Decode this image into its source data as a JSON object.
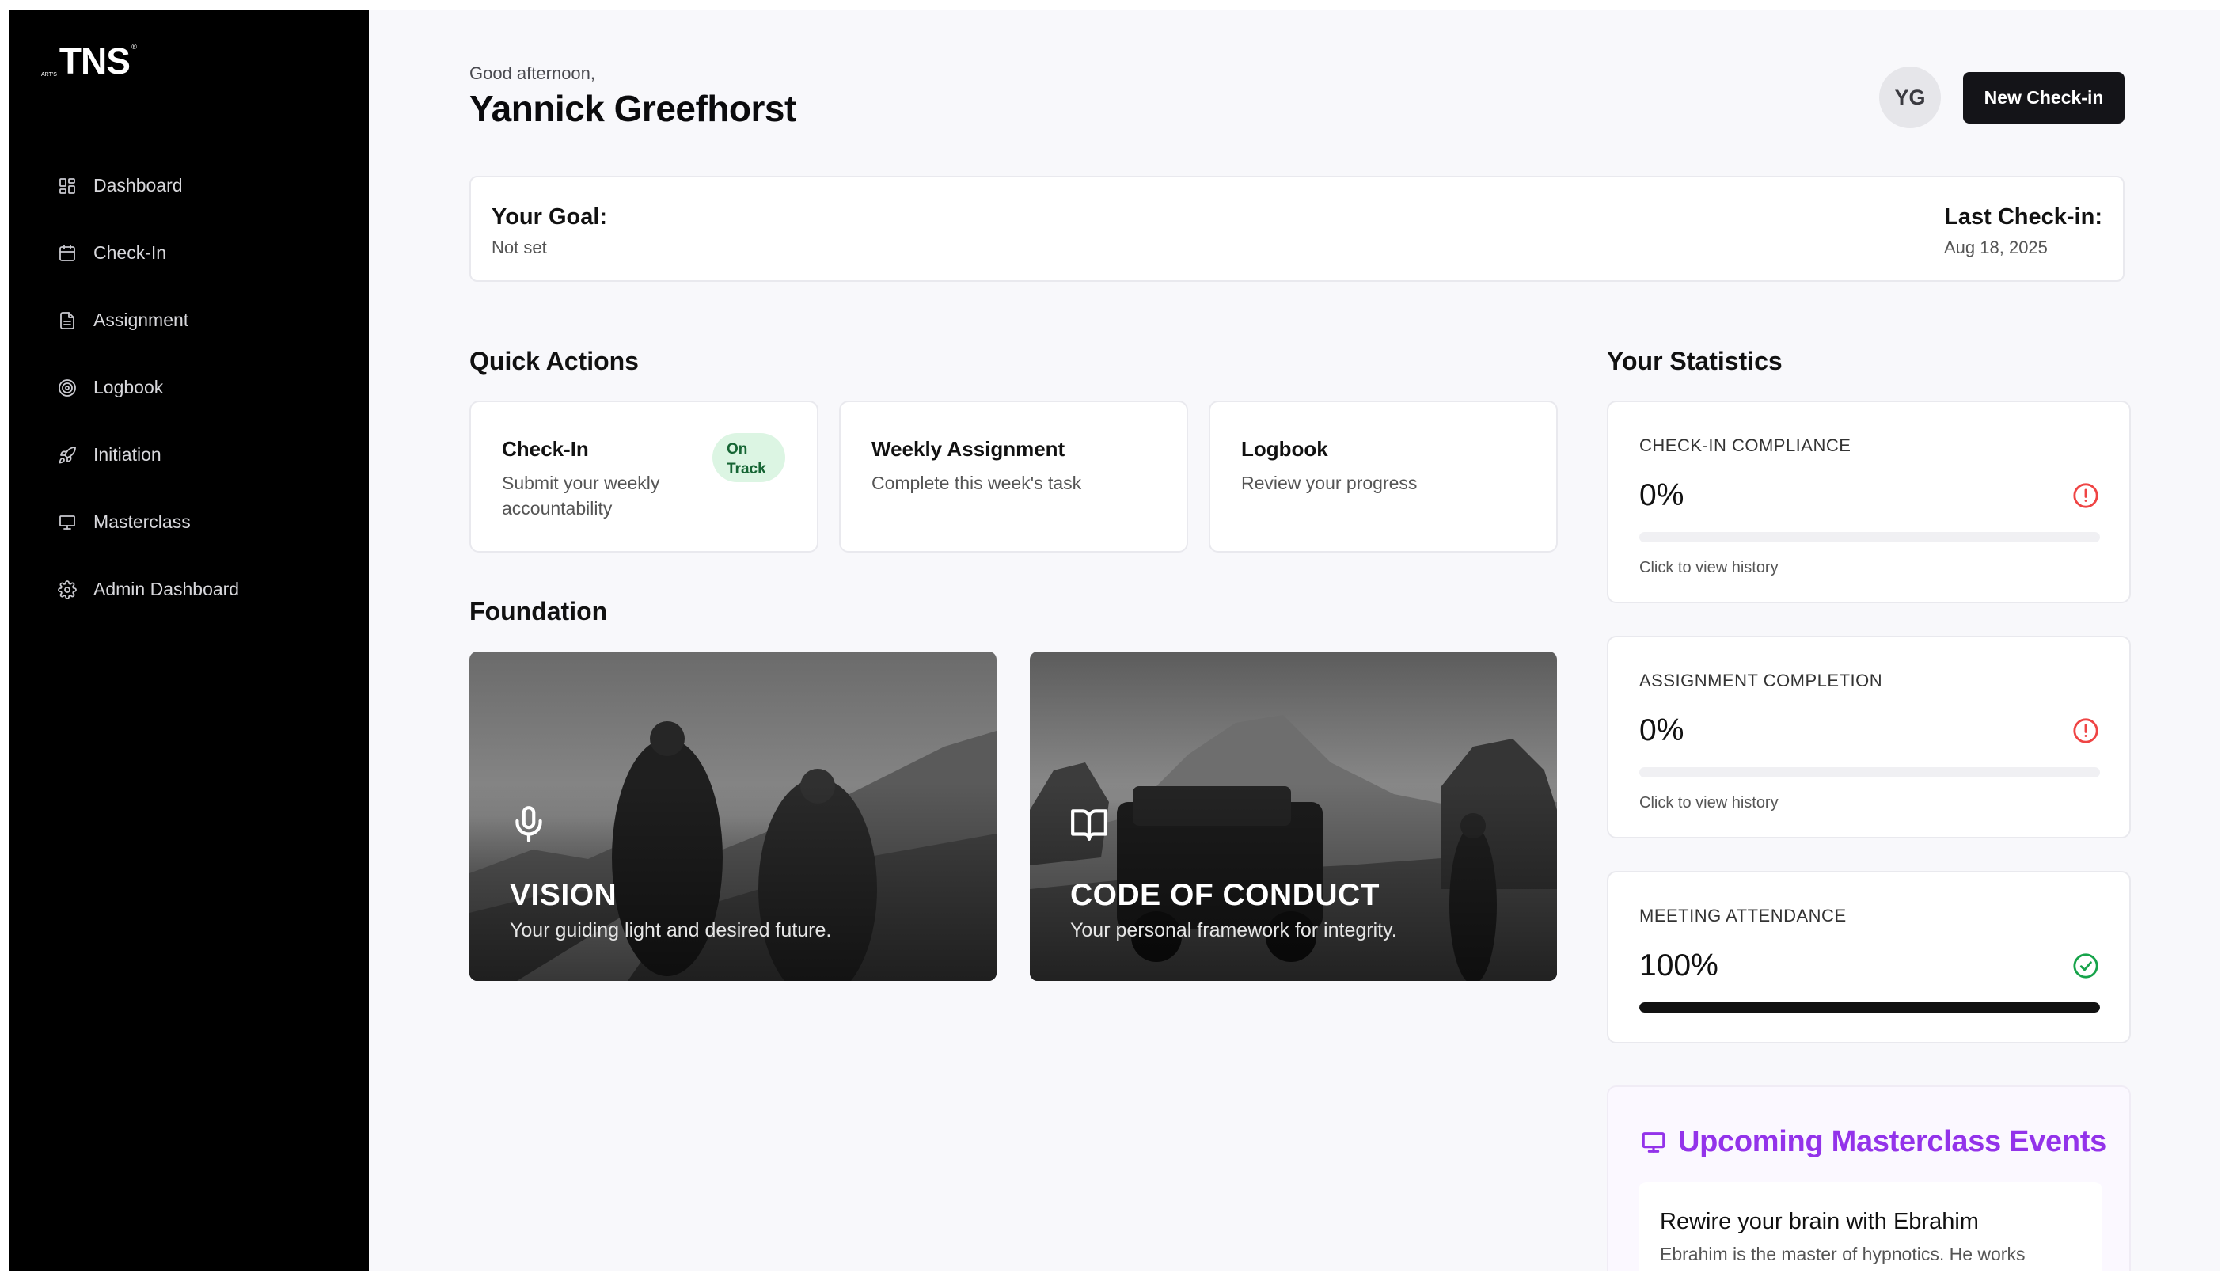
{
  "brand": {
    "small": "ART'S",
    "name": "TNS",
    "mark": "®"
  },
  "sidebar": {
    "items": [
      {
        "label": "Dashboard",
        "icon": "dashboard-icon"
      },
      {
        "label": "Check-In",
        "icon": "calendar-icon"
      },
      {
        "label": "Assignment",
        "icon": "document-icon"
      },
      {
        "label": "Logbook",
        "icon": "target-icon"
      },
      {
        "label": "Initiation",
        "icon": "rocket-icon"
      },
      {
        "label": "Masterclass",
        "icon": "presentation-icon"
      },
      {
        "label": "Admin Dashboard",
        "icon": "gear-icon"
      }
    ]
  },
  "header": {
    "greeting": "Good afternoon,",
    "user_name": "Yannick Greefhorst",
    "avatar_initials": "YG",
    "new_checkin_label": "New Check-in"
  },
  "goal": {
    "label": "Your Goal:",
    "value": "Not set",
    "last_checkin_label": "Last Check-in:",
    "last_checkin_value": "Aug 18, 2025"
  },
  "quick_actions": {
    "title": "Quick Actions",
    "items": [
      {
        "title": "Check-In",
        "subtitle": "Submit your weekly accountability",
        "badge": "On Track"
      },
      {
        "title": "Weekly Assignment",
        "subtitle": "Complete this week's task"
      },
      {
        "title": "Logbook",
        "subtitle": "Review your progress"
      }
    ]
  },
  "foundation": {
    "title": "Foundation",
    "items": [
      {
        "title": "VISION",
        "subtitle": "Your guiding light and desired future.",
        "icon": "microphone-icon"
      },
      {
        "title": "CODE OF CONDUCT",
        "subtitle": "Your personal framework for integrity.",
        "icon": "book-open-icon"
      }
    ]
  },
  "statistics": {
    "title": "Your Statistics",
    "items": [
      {
        "label": "CHECK-IN COMPLIANCE",
        "value": "0%",
        "progress": 0,
        "hint": "Click to view history",
        "status": "alert",
        "status_color": "#ef4444"
      },
      {
        "label": "ASSIGNMENT COMPLETION",
        "value": "0%",
        "progress": 0,
        "hint": "Click to view history",
        "status": "alert",
        "status_color": "#ef4444"
      },
      {
        "label": "MEETING ATTENDANCE",
        "value": "100%",
        "progress": 1,
        "status": "ok",
        "status_color": "#16a34a"
      }
    ]
  },
  "masterclass": {
    "title": "Upcoming Masterclass Events",
    "accent": "#9333ea",
    "event_title": "Rewire your brain with Ebrahim",
    "event_desc": "Ebrahim is the master of hypnotics. He works with the highest level"
  }
}
